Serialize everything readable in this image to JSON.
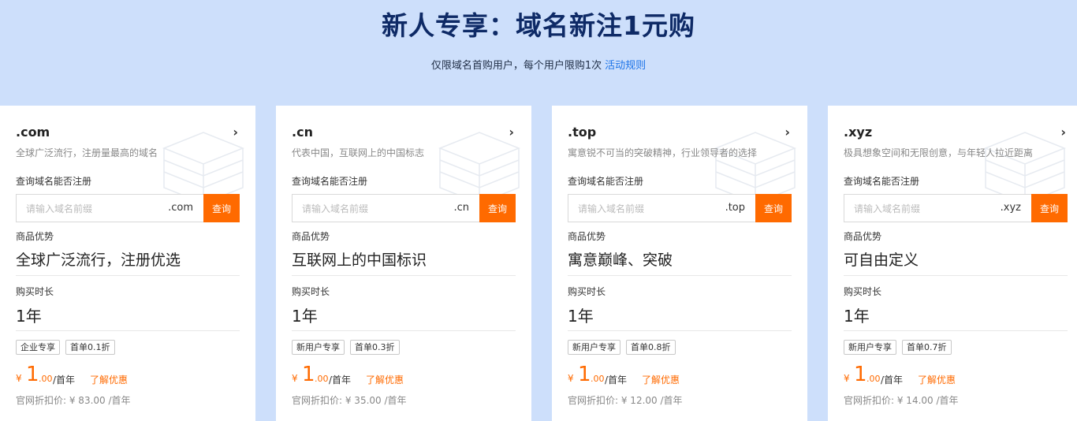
{
  "header": {
    "title": "新人专享：域名新注1元购",
    "subtitle": "仅限域名首购用户，每个用户限购1次",
    "rules_link": "活动规则"
  },
  "common": {
    "query_label": "查询域名能否注册",
    "input_placeholder": "请输入域名前缀",
    "query_button": "查询",
    "advantage_label": "商品优势",
    "duration_label": "购买时长",
    "duration_value": "1年",
    "currency": "¥",
    "price_integer": "1",
    "price_decimal": ".00",
    "price_unit": "/首年",
    "promo_link": "了解优惠"
  },
  "cards": [
    {
      "tld": ".com",
      "description": "全球广泛流行，注册量最高的域名",
      "suffix": ".com",
      "advantage": "全球广泛流行，注册优选",
      "tag1": "企业专享",
      "tag2": "首单0.1折",
      "original_price": "官网折扣价: ¥ 83.00 /首年"
    },
    {
      "tld": ".cn",
      "description": "代表中国，互联网上的中国标志",
      "suffix": ".cn",
      "advantage": "互联网上的中国标识",
      "tag1": "新用户专享",
      "tag2": "首单0.3折",
      "original_price": "官网折扣价: ¥ 35.00 /首年"
    },
    {
      "tld": ".top",
      "description": "寓意锐不可当的突破精神，行业领导者的选择",
      "suffix": ".top",
      "advantage": "寓意巅峰、突破",
      "tag1": "新用户专享",
      "tag2": "首单0.8折",
      "original_price": "官网折扣价: ¥ 12.00 /首年"
    },
    {
      "tld": ".xyz",
      "description": "极具想象空间和无限创意，与年轻人拉近距离",
      "suffix": ".xyz",
      "advantage": "可自由定义",
      "tag1": "新用户专享",
      "tag2": "首单0.7折",
      "original_price": "官网折扣价: ¥ 14.00 /首年"
    }
  ],
  "icons": {
    "card_arrow": "chevron-right-icon",
    "card_decoration": "server-illustration-icon"
  },
  "colors": {
    "accent": "#ff6a00",
    "title": "#0e2a66",
    "link": "#1d74e8",
    "background": "#cddffb"
  }
}
